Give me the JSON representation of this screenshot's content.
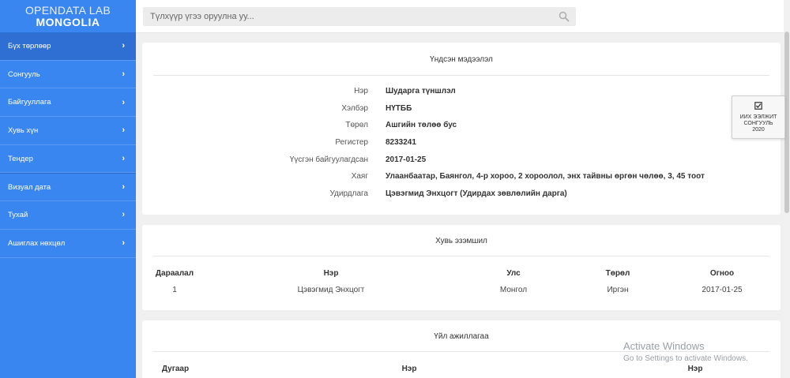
{
  "brand": {
    "top": "OPENDATA LAB",
    "bottom": "MONGOLIA"
  },
  "sidebar": {
    "items": [
      {
        "label": "Бүх төрлөөр"
      },
      {
        "label": "Сонгууль"
      },
      {
        "label": "Байгууллага"
      },
      {
        "label": "Хувь хүн"
      },
      {
        "label": "Тендер"
      },
      {
        "label": "Визуал дата"
      },
      {
        "label": "Тухай"
      },
      {
        "label": "Ашиглах нөхцөл"
      }
    ]
  },
  "search": {
    "placeholder": "Түлхүүр үгээ оруулна уу..."
  },
  "info_card": {
    "title": "Үндсэн мэдээлэл",
    "rows": [
      {
        "label": "Нэр",
        "value": "Шударга түншлэл"
      },
      {
        "label": "Хэлбэр",
        "value": "НҮТББ"
      },
      {
        "label": "Төрөл",
        "value": "Ашгийн төлөө бус"
      },
      {
        "label": "Регистер",
        "value": "8233241"
      },
      {
        "label": "Үүсгэн байгуулагдсан",
        "value": "2017-01-25"
      },
      {
        "label": "Хаяг",
        "value": "Улаанбаатар, Баянгол, 4-р хороо, 2 хороолол, энх тайвны өргөн чөлөө, 3, 45 тоот"
      },
      {
        "label": "Удирдлага",
        "value": "Цэвэгмид Энхцогт (Удирдах зөвлөлийн дарга)"
      }
    ]
  },
  "ownership_card": {
    "title": "Хувь эзэмшил",
    "headers": [
      "Дараалал",
      "Нэр",
      "Улс",
      "Төрөл",
      "Огноо"
    ],
    "rows": [
      [
        "1",
        "Цэвэгмид Энхцогт",
        "Монгол",
        "Иргэн",
        "2017-01-25"
      ]
    ]
  },
  "activity_card": {
    "title": "Үйл ажиллагаа",
    "headers": [
      "Дугаар",
      "Нэр",
      "Нэр"
    ]
  },
  "election_box": {
    "line1": "ИИХ ЭЭЛЖИТ",
    "line2": "СОНГУУЛЬ",
    "line3": "2020"
  },
  "watermark": {
    "title": "Activate Windows",
    "subtitle": "Go to Settings to activate Windows."
  },
  "icons": {
    "search": "search-icon",
    "check": "checkbox-icon",
    "chevron": "chevron-right-icon"
  },
  "colors": {
    "sidebar": "#3a86f0",
    "sidebar_active": "#2f6fd3"
  }
}
